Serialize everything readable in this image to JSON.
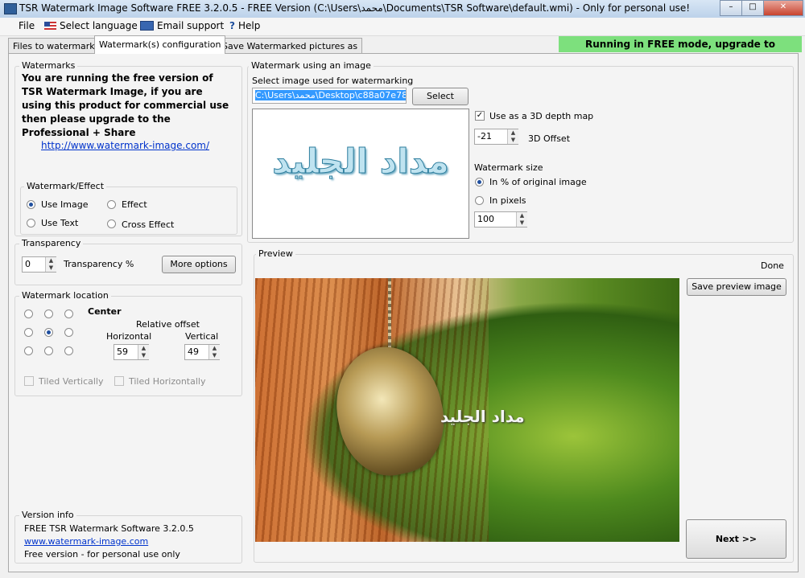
{
  "window": {
    "title": "TSR Watermark Image Software FREE 3.2.0.5 - FREE Version (C:\\Users\\محمد\\Documents\\TSR Software\\default.wmi) - Only for personal use!",
    "minimize": "–",
    "maximize": "□",
    "close": "✕"
  },
  "menu": {
    "file": "File",
    "language": "Select language",
    "email": "Email support",
    "help_icon": "?",
    "help": "Help",
    "banner": "Running in FREE mode, upgrade to PROFESSIONAL"
  },
  "tabs": [
    "Files to watermark",
    "Watermark(s) configuration",
    "Save Watermarked pictures as"
  ],
  "watermarks": {
    "legend": "Watermarks",
    "notice": "You are running the free version of TSR Watermark Image, if you are using this product for commercial use then please upgrade to the Professional + Share",
    "link": "http://www.watermark-image.com/"
  },
  "effect": {
    "legend": "Watermark/Effect",
    "use_image": "Use Image",
    "effect": "Effect",
    "use_text": "Use Text",
    "cross_effect": "Cross Effect",
    "selected": "Use Image"
  },
  "transparency": {
    "legend": "Transparency",
    "value": "0",
    "label": "Transparency %",
    "more_options": "More options"
  },
  "location": {
    "legend": "Watermark location",
    "position": "Center",
    "relative_offset": "Relative offset",
    "horizontal_label": "Horizontal",
    "vertical_label": "Vertical",
    "horizontal": "59",
    "vertical": "49",
    "tiled_v": "Tiled Vertically",
    "tiled_h": "Tiled Horizontally"
  },
  "version": {
    "legend": "Version info",
    "line1": "FREE TSR Watermark Software 3.2.0.5",
    "link": "www.watermark-image.com",
    "line3": "Free version - for personal use only"
  },
  "image_wm": {
    "legend": "Watermark using an image",
    "select_label": "Select image used for watermarking",
    "path": "C:\\Users\\محمد\\Desktop\\c88a07e78fe...",
    "select_button": "Select",
    "depth_map": "Use as a 3D depth map",
    "depth_checked": true,
    "offset_value": "-21",
    "offset_label": "3D Offset",
    "size_label": "Watermark size",
    "size_percent": "In % of original image",
    "size_pixels": "In pixels",
    "size_value": "100",
    "watermark_text": "مداد الجليد"
  },
  "preview": {
    "legend": "Preview",
    "status": "Done",
    "save_button": "Save preview image",
    "next_button": "Next >>",
    "watermark_text": "مداد الجليد"
  }
}
